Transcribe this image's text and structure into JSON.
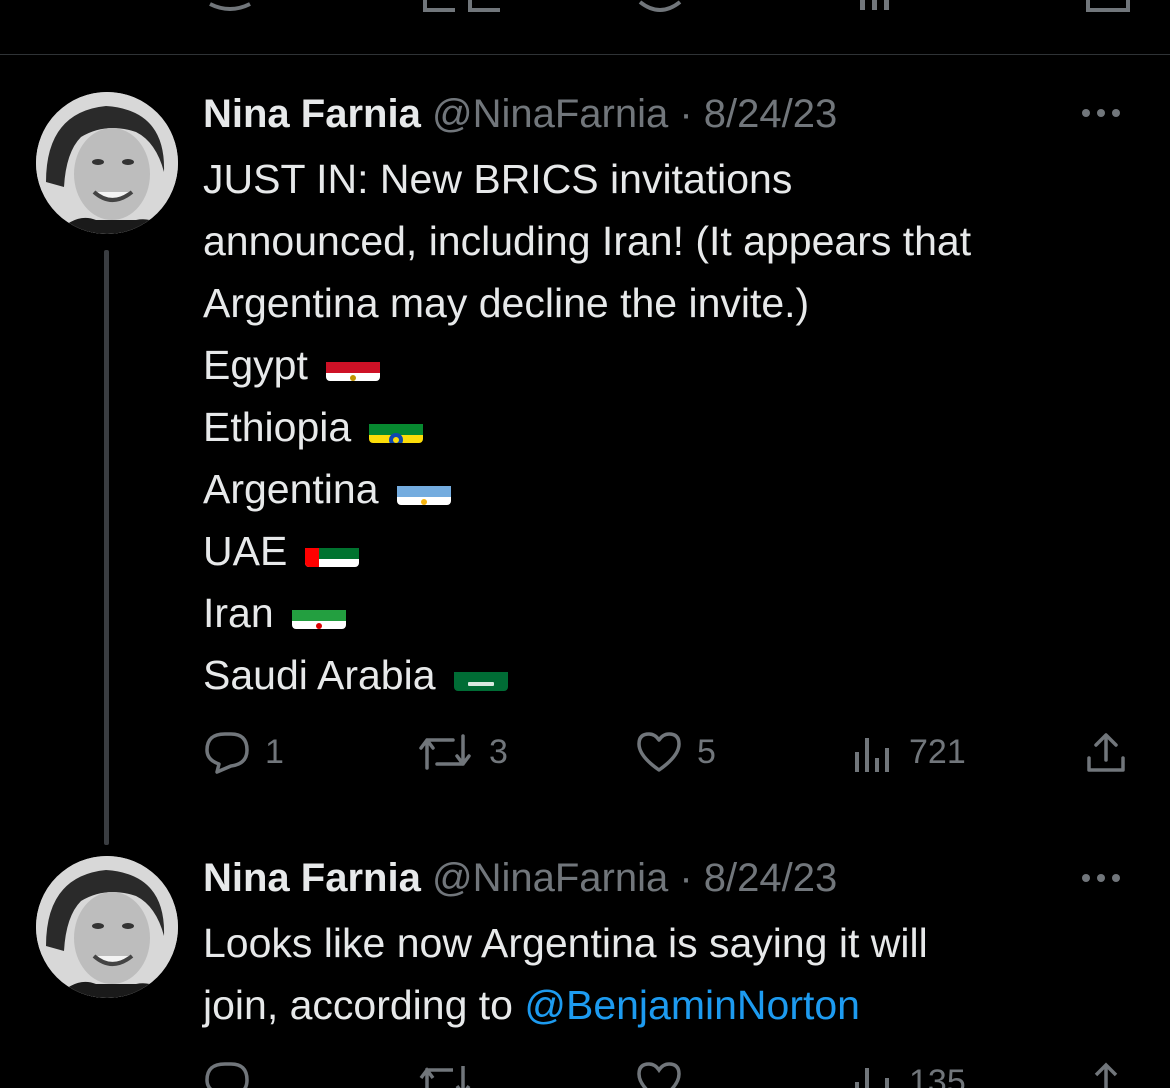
{
  "tweets": [
    {
      "author_name": "Nina Farnia",
      "handle": "@NinaFarnia",
      "separator": "·",
      "date": "8/24/23",
      "lines": [
        "JUST IN: New BRICS invitations",
        "announced, including Iran! (It appears that",
        "Argentina may decline the invite.)"
      ],
      "countries": [
        {
          "name": "Egypt",
          "flag": "egypt-flag-icon"
        },
        {
          "name": "Ethiopia",
          "flag": "ethiopia-flag-icon"
        },
        {
          "name": "Argentina",
          "flag": "argentina-flag-icon"
        },
        {
          "name": "UAE",
          "flag": "uae-flag-icon"
        },
        {
          "name": "Iran",
          "flag": "iran-flag-icon"
        },
        {
          "name": "Saudi Arabia",
          "flag": "saudi-arabia-flag-icon"
        }
      ],
      "stats": {
        "replies": "1",
        "retweets": "3",
        "likes": "5",
        "views": "721"
      }
    },
    {
      "author_name": "Nina Farnia",
      "handle": "@NinaFarnia",
      "separator": "·",
      "date": "8/24/23",
      "line1": "Looks like now Argentina is saying it will",
      "line2_prefix": "join, according to ",
      "mention": "@BenjaminNorton",
      "stats": {
        "views": "135"
      }
    }
  ],
  "colors": {
    "background": "#000000",
    "text": "#e7e9ea",
    "muted": "#71767b",
    "link": "#1d9bf0",
    "divider": "#2f3336"
  }
}
